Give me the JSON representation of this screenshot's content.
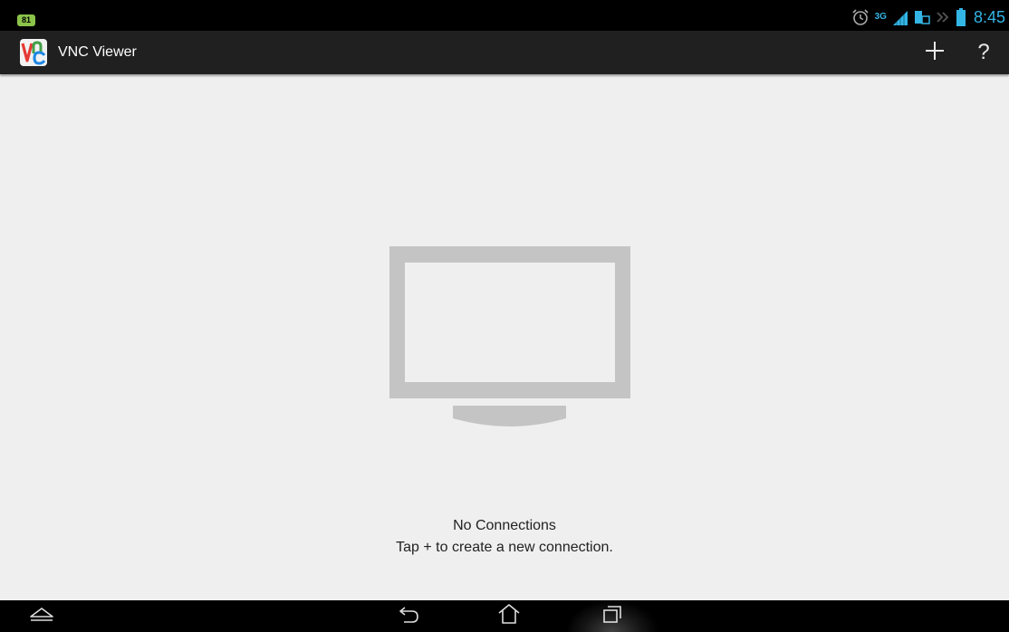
{
  "status_bar": {
    "notification_badge": "81",
    "network_type": "3G",
    "clock": "8:45",
    "icons": [
      "notification-badge",
      "alarm-icon",
      "signal-icon",
      "sim-icon",
      "data-arrows-icon",
      "battery-icon"
    ]
  },
  "action_bar": {
    "app_name": "VNC Viewer",
    "logo_icon": "vnc-logo-icon",
    "add_icon": "plus-icon",
    "help_label": "?"
  },
  "empty_state": {
    "icon": "monitor-icon",
    "title": "No Connections",
    "hint": "Tap + to create a new connection."
  },
  "nav_bar": {
    "icons": [
      "menu-chevron-icon",
      "back-icon",
      "home-icon",
      "recent-apps-icon"
    ]
  },
  "colors": {
    "status_accent": "#33b5e5",
    "action_bar_bg": "#202020",
    "content_bg": "#efefef",
    "monitor_gray": "#c4c4c4",
    "badge_green": "#8bc34a"
  }
}
